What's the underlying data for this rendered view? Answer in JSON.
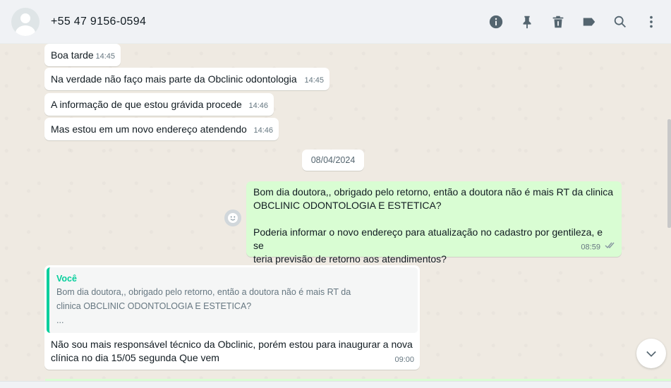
{
  "header": {
    "contact_name": "+55 47 9156-0594",
    "icons": [
      "info-icon",
      "pin-icon",
      "delete-icon",
      "label-icon",
      "search-icon",
      "menu-icon"
    ]
  },
  "messages": [
    {
      "text": "Boa tarde",
      "time": "14:45",
      "direction": "in"
    },
    {
      "text": "Na verdade não faço mais parte da Obclinic odontologia",
      "time": "14:45",
      "direction": "in"
    },
    {
      "text": "A informação de que estou grávida procede",
      "time": "14:46",
      "direction": "in"
    },
    {
      "text": "Mas estou em um novo endereço atendendo",
      "time": "14:46",
      "direction": "in"
    }
  ],
  "date_separator": "08/04/2024",
  "outgoing": {
    "line1": "Bom dia doutora,, obrigado pelo retorno, então a doutora não é mais RT da clinica",
    "line2": "OBCLINIC ODONTOLOGIA E ESTETICA?",
    "line3": "Poderia informar o novo endereço para atualização no cadastro por gentileza, e se",
    "line4": "teria previsão de retorno aos atendimentos?",
    "time": "08:59",
    "status": "read"
  },
  "reply": {
    "quote_author": "Você",
    "quote_line1": "Bom dia doutora,, obrigado pelo retorno, então a doutora não é mais RT da",
    "quote_line2": "clinica OBCLINIC ODONTOLOGIA E ESTETICA?",
    "quote_line3": "...",
    "text_line1": "Não sou mais responsável técnico da Obclinic, porém estou para inaugurar a nova",
    "text_line2": "clínica no dia 15/05 segunda Que vem",
    "time": "09:00"
  },
  "colors": {
    "header_bg": "#f0f2f5",
    "chat_bg": "#efeae2",
    "outgoing_bubble": "#d9fdd3",
    "incoming_bubble": "#ffffff",
    "accent": "#06cf9c",
    "read_ticks": "#8696a0"
  }
}
